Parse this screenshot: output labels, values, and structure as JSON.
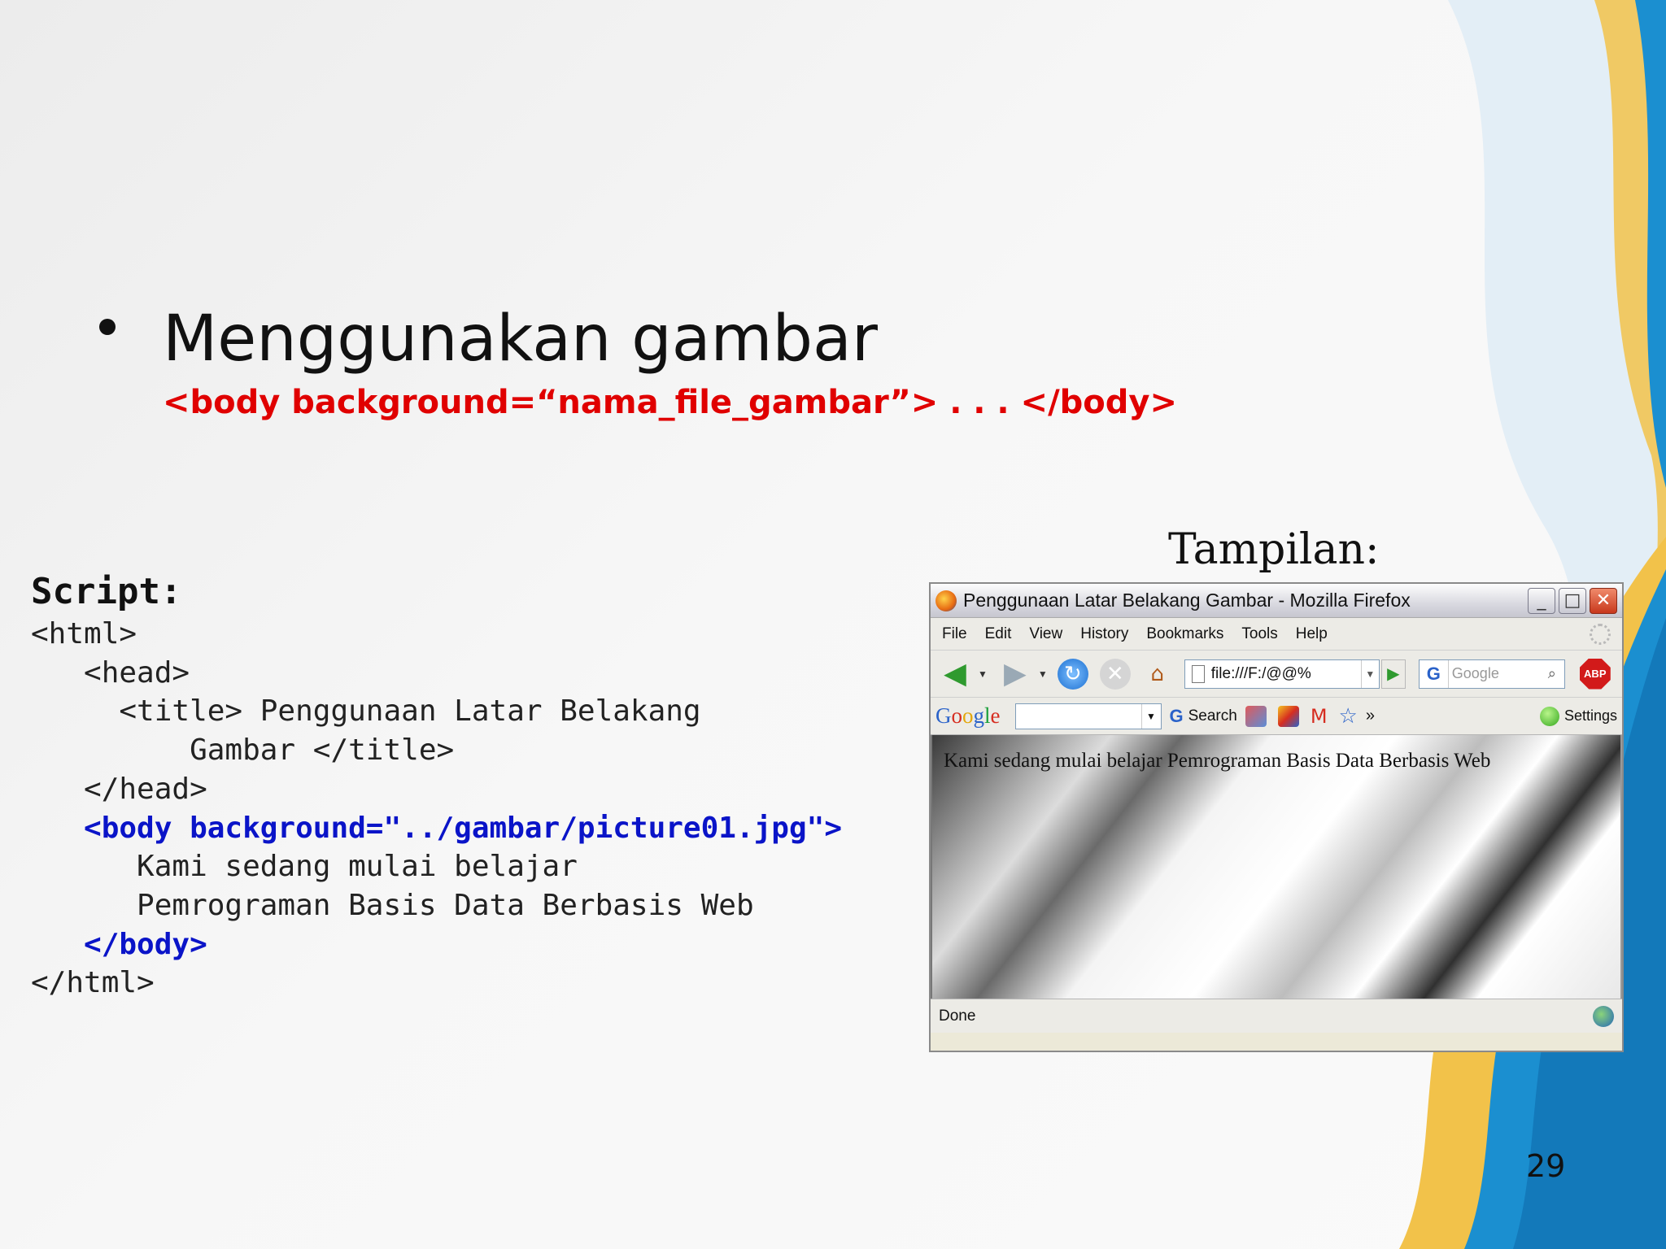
{
  "slide": {
    "heading": "Menggunakan gambar",
    "syntax": "<body background=“nama_file_gambar”> . . . </body>",
    "page_number": "29"
  },
  "script": {
    "label": "Script:",
    "lines": {
      "l1": "<html>",
      "l2": "   <head>",
      "l3": "     <title> Penggunaan Latar Belakang",
      "l4": "         Gambar </title>",
      "l5": "   </head>",
      "l6": "   <body background=\"../gambar/picture01.jpg\">",
      "l7": "      Kami sedang mulai belajar",
      "l8": "      Pemrograman Basis Data Berbasis Web",
      "l9": "   </body>",
      "l10": "</html>"
    }
  },
  "tampilan": {
    "label": "Tampilan:"
  },
  "browser": {
    "title": "Penggunaan Latar Belakang Gambar - Mozilla Firefox",
    "window_buttons": {
      "minimize": "_",
      "maximize": "□",
      "close": "✕"
    },
    "menu": [
      "File",
      "Edit",
      "View",
      "History",
      "Bookmarks",
      "Tools",
      "Help"
    ],
    "url": "file:///F:/@@%",
    "search_placeholder": "Google",
    "google_toolbar": {
      "search_label": "Search",
      "settings_label": "Settings",
      "more": "»"
    },
    "content_text": "Kami sedang mulai belajar Pemrograman Basis Data Berbasis Web",
    "status": "Done",
    "abp_label": "ABP"
  },
  "colors": {
    "syntax_red": "#e00000",
    "code_blue": "#0a14c8",
    "deco_blue": "#1b8fd0",
    "deco_gold": "#f2c24a"
  },
  "icons": {
    "back": "back-arrow-icon",
    "forward": "forward-arrow-icon",
    "reload": "reload-icon",
    "stop": "stop-icon",
    "home": "home-icon"
  }
}
